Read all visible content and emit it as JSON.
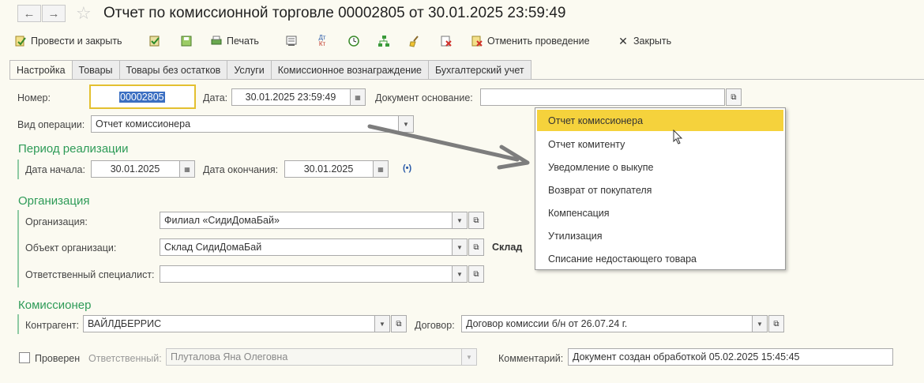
{
  "window": {
    "title": "Отчет по комиссионной торговле 00002805 от 30.01.2025 23:59:49"
  },
  "toolbar": {
    "post_close": "Провести и закрыть",
    "print": "Печать",
    "unpost": "Отменить проведение",
    "close": "Закрыть"
  },
  "tabs": [
    "Настройка",
    "Товары",
    "Товары без остатков",
    "Услуги",
    "Комиссионное вознаграждение",
    "Бухгалтерский учет"
  ],
  "form": {
    "number_label": "Номер:",
    "number_value": "00002805",
    "date_label": "Дата:",
    "date_value": "30.01.2025 23:59:49",
    "basis_label": "Документ основание:",
    "basis_value": "",
    "operation_label": "Вид операции:",
    "operation_value": "Отчет комиссионера",
    "period_title": "Период реализации",
    "start_label": "Дата начала:",
    "start_value": "30.01.2025",
    "end_label": "Дата окончания:",
    "end_value": "30.01.2025",
    "org_title": "Организация",
    "org_label": "Организация:",
    "org_value": "Филиал «СидиДомаБай»",
    "org_object_label": "Объект организаци:",
    "org_object_value": "Склад СидиДомаБай",
    "org_object_type": "Склад",
    "responsible_label": "Ответственный специалист:",
    "responsible_value": "",
    "commissioner_title": "Комиссионер",
    "counterparty_label": "Контрагент:",
    "counterparty_value": "ВАЙЛДБЕРРИС",
    "contract_label": "Договор:",
    "contract_value": "Договор комиссии б/н от 26.07.24 г.",
    "checked_label": "Проверен",
    "checked": false,
    "resp_label": "Ответственный:",
    "resp_value": "Плуталова Яна Олеговна",
    "comment_label": "Комментарий:",
    "comment_value": "Документ создан обработкой 05.02.2025 15:45:45"
  },
  "dropdown": {
    "selected": "Отчет комиссионера",
    "items": [
      "Отчет комиссионера",
      "Отчет комитенту",
      "Уведомление о выкупе",
      "Возврат от покупателя",
      "Компенсация",
      "Утилизация",
      "Списание недостающего товара"
    ]
  },
  "colors": {
    "background": "#fbfaf1",
    "section_green": "#2e9b58",
    "highlight_yellow": "#f5d23c",
    "focus_border": "#e3c030"
  }
}
